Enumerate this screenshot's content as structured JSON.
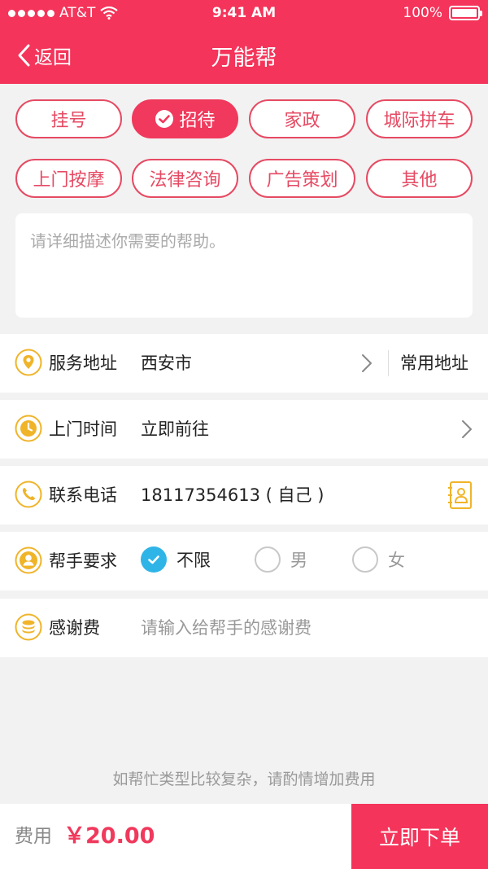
{
  "status_bar": {
    "carrier": "AT&T",
    "time": "9:41 AM",
    "battery": "100%"
  },
  "nav": {
    "back_label": "返回",
    "title": "万能帮"
  },
  "colors": {
    "accent": "#f4345a",
    "icon_gold": "#f0b429",
    "radio_checked": "#2fb4e8"
  },
  "categories": [
    {
      "label": "挂号",
      "active": false
    },
    {
      "label": "招待",
      "active": true
    },
    {
      "label": "家政",
      "active": false
    },
    {
      "label": "城际拼车",
      "active": false
    },
    {
      "label": "上门按摩",
      "active": false
    },
    {
      "label": "法律咨询",
      "active": false
    },
    {
      "label": "广告策划",
      "active": false
    },
    {
      "label": "其他",
      "active": false
    }
  ],
  "description": {
    "placeholder": "请详细描述你需要的帮助。",
    "value": ""
  },
  "form": {
    "address": {
      "label": "服务地址",
      "value": "西安市",
      "common_label": "常用地址",
      "icon": "location-pin-icon"
    },
    "time": {
      "label": "上门时间",
      "value": "立即前往",
      "icon": "clock-icon"
    },
    "phone": {
      "label": "联系电话",
      "value": "18117354613 ( 自己 )",
      "icon": "phone-icon"
    },
    "helper": {
      "label": "帮手要求",
      "icon": "person-icon",
      "options": [
        {
          "label": "不限",
          "checked": true
        },
        {
          "label": "男",
          "checked": false
        },
        {
          "label": "女",
          "checked": false
        }
      ]
    },
    "tip": {
      "label": "感谢费",
      "placeholder": "请输入给帮手的感谢费",
      "icon": "coins-icon"
    }
  },
  "notice": "如帮忙类型比较复杂，请酌情增加费用",
  "footer": {
    "fee_label": "费用",
    "fee_amount": "￥20.00",
    "submit_label": "立即下单"
  }
}
